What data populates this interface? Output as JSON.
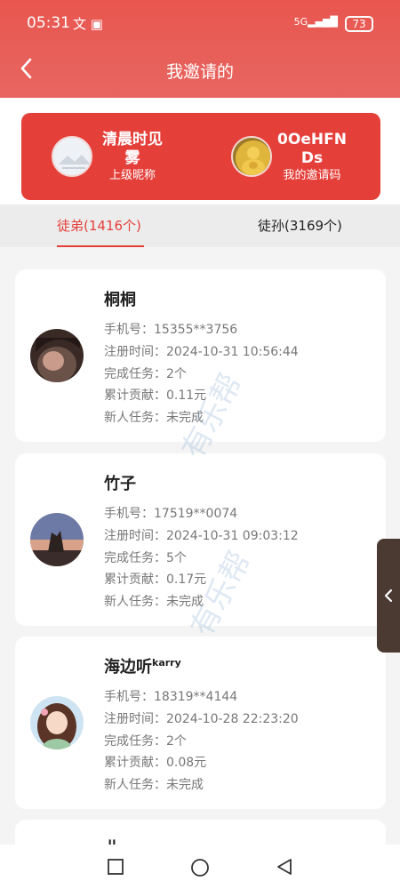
{
  "status_bar": {
    "time": "05:31",
    "network": "5G",
    "battery": "73"
  },
  "header": {
    "title": "我邀请的"
  },
  "card": {
    "nickname": "清晨时见雾",
    "nickname_line1": "清晨时见",
    "nickname_line2": "雾",
    "nickname_label": "上级昵称",
    "invite_code_line1": "0OeHFN",
    "invite_code_line2": "Ds",
    "invite_code_label": "我的邀请码"
  },
  "tabs": [
    {
      "label": "徒弟(1416个)",
      "active": true
    },
    {
      "label": "徒孙(3169个)",
      "active": false
    }
  ],
  "field_labels": {
    "phone": "手机号：",
    "register": "注册时间：",
    "tasks": "完成任务：",
    "contribution": "累计贡献：",
    "newbie": "新人任务："
  },
  "members": [
    {
      "name": "桐桐",
      "name_sup": "",
      "phone": "15355**3756",
      "register": "2024-10-31 10:56:44",
      "tasks": "2个",
      "contribution": "0.11元",
      "newbie": "未完成"
    },
    {
      "name": "竹子",
      "name_sup": "",
      "phone": "17519**0074",
      "register": "2024-10-31 09:03:12",
      "tasks": "5个",
      "contribution": "0.17元",
      "newbie": "未完成"
    },
    {
      "name": "海边听",
      "name_sup": "karry",
      "phone": "18319**4144",
      "register": "2024-10-28 22:23:20",
      "tasks": "2个",
      "contribution": "0.08元",
      "newbie": "未完成"
    }
  ],
  "watermark": "有乐帮"
}
